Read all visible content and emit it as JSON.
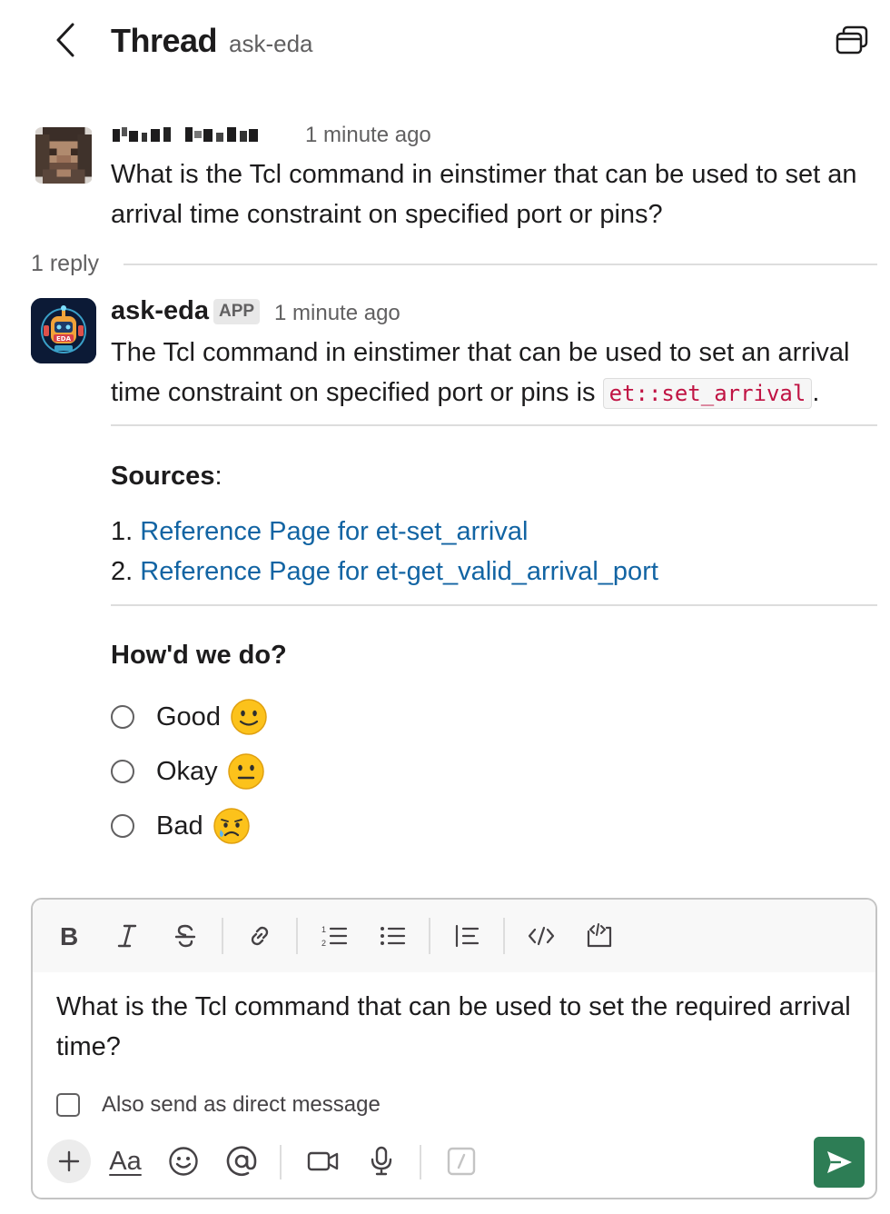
{
  "header": {
    "title": "Thread",
    "channel": "ask-eda"
  },
  "thread": {
    "parent": {
      "timestamp": "1 minute ago",
      "text": "What is the Tcl command in einstimer that can be used to set an arrival time constraint on specified port or pins?"
    },
    "reply_count": "1 reply",
    "reply": {
      "author": "ask-eda",
      "badge": "APP",
      "timestamp": "1 minute ago",
      "text_before": "The Tcl command in einstimer that can be used to set an arrival time constraint on specified port or pins is ",
      "code": "et::set_arrival",
      "text_after": ".",
      "avatar_text": "EDA",
      "sources_heading": "Sources",
      "sources_colon": ":",
      "sources": [
        {
          "num": "1.",
          "label": "Reference Page for et-set_arrival"
        },
        {
          "num": "2.",
          "label": "Reference Page for et-get_valid_arrival_port"
        }
      ],
      "feedback_heading": "How'd we do?",
      "feedback_options": [
        {
          "label": "Good",
          "emoji": "slightly-smiling-face-icon"
        },
        {
          "label": "Okay",
          "emoji": "neutral-face-icon"
        },
        {
          "label": "Bad",
          "emoji": "crying-face-icon"
        }
      ]
    }
  },
  "composer": {
    "text": "What is the Tcl command that can be used to set the required arrival time?",
    "dm_label": "Also send as direct message",
    "format_label": "Aa"
  },
  "colors": {
    "link": "#1264a3",
    "send": "#2d7d55",
    "code": "#c01343",
    "muted": "#616061"
  }
}
